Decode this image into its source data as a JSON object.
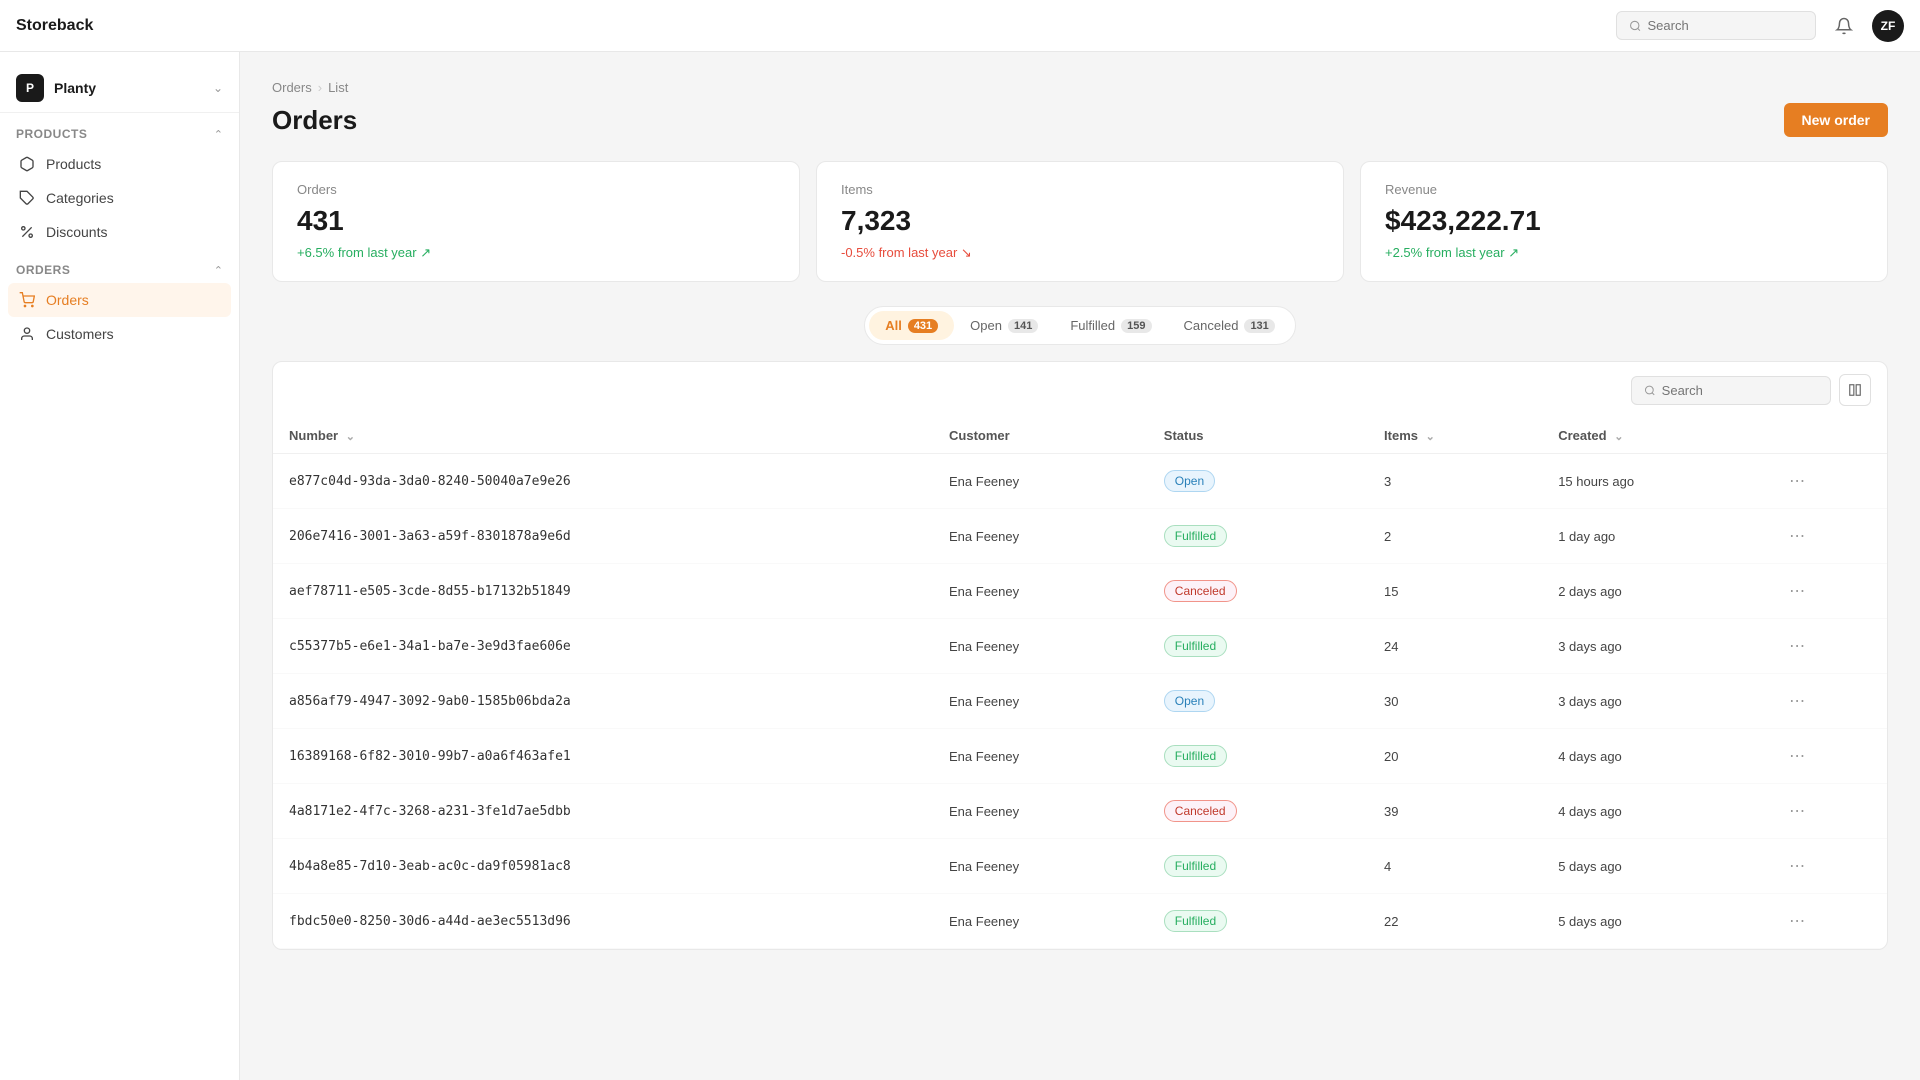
{
  "app": {
    "brand": "Storeback",
    "avatar": "ZF"
  },
  "topbar": {
    "search_placeholder": "Search"
  },
  "sidebar": {
    "store_name": "Planty",
    "store_initial": "P",
    "products_section": "Products",
    "orders_section": "Orders",
    "items": [
      {
        "id": "products",
        "label": "Products",
        "icon": "box"
      },
      {
        "id": "categories",
        "label": "Categories",
        "icon": "tag"
      },
      {
        "id": "discounts",
        "label": "Discounts",
        "icon": "percent"
      },
      {
        "id": "orders",
        "label": "Orders",
        "icon": "cart",
        "active": true
      },
      {
        "id": "customers",
        "label": "Customers",
        "icon": "user"
      }
    ]
  },
  "breadcrumb": {
    "parent": "Orders",
    "current": "List"
  },
  "page": {
    "title": "Orders",
    "new_order_label": "New order"
  },
  "stats": [
    {
      "id": "orders",
      "label": "Orders",
      "value": "431",
      "change": "+6.5% from last year",
      "positive": true
    },
    {
      "id": "items",
      "label": "Items",
      "value": "7,323",
      "change": "-0.5% from last year",
      "positive": false
    },
    {
      "id": "revenue",
      "label": "Revenue",
      "value": "$423,222.71",
      "change": "+2.5% from last year",
      "positive": true
    }
  ],
  "filter_tabs": [
    {
      "id": "all",
      "label": "All",
      "count": "431",
      "active": true
    },
    {
      "id": "open",
      "label": "Open",
      "count": "141",
      "active": false
    },
    {
      "id": "fulfilled",
      "label": "Fulfilled",
      "count": "159",
      "active": false
    },
    {
      "id": "canceled",
      "label": "Canceled",
      "count": "131",
      "active": false
    }
  ],
  "table": {
    "search_placeholder": "Search",
    "columns": [
      {
        "id": "number",
        "label": "Number",
        "sortable": true
      },
      {
        "id": "customer",
        "label": "Customer",
        "sortable": false
      },
      {
        "id": "status",
        "label": "Status",
        "sortable": false
      },
      {
        "id": "items",
        "label": "Items",
        "sortable": true
      },
      {
        "id": "created",
        "label": "Created",
        "sortable": true
      }
    ],
    "rows": [
      {
        "id": "e877c04d-93da-3da0-8240-50040a7e9e26",
        "customer": "Ena Feeney",
        "status": "Open",
        "items": "3",
        "created": "15 hours ago"
      },
      {
        "id": "206e7416-3001-3a63-a59f-8301878a9e6d",
        "customer": "Ena Feeney",
        "status": "Fulfilled",
        "items": "2",
        "created": "1 day ago"
      },
      {
        "id": "aef78711-e505-3cde-8d55-b17132b51849",
        "customer": "Ena Feeney",
        "status": "Canceled",
        "items": "15",
        "created": "2 days ago"
      },
      {
        "id": "c55377b5-e6e1-34a1-ba7e-3e9d3fae606e",
        "customer": "Ena Feeney",
        "status": "Fulfilled",
        "items": "24",
        "created": "3 days ago"
      },
      {
        "id": "a856af79-4947-3092-9ab0-1585b06bda2a",
        "customer": "Ena Feeney",
        "status": "Open",
        "items": "30",
        "created": "3 days ago"
      },
      {
        "id": "16389168-6f82-3010-99b7-a0a6f463afe1",
        "customer": "Ena Feeney",
        "status": "Fulfilled",
        "items": "20",
        "created": "4 days ago"
      },
      {
        "id": "4a8171e2-4f7c-3268-a231-3fe1d7ae5dbb",
        "customer": "Ena Feeney",
        "status": "Canceled",
        "items": "39",
        "created": "4 days ago"
      },
      {
        "id": "4b4a8e85-7d10-3eab-ac0c-da9f05981ac8",
        "customer": "Ena Feeney",
        "status": "Fulfilled",
        "items": "4",
        "created": "5 days ago"
      },
      {
        "id": "fbdc50e0-8250-30d6-a44d-ae3ec5513d96",
        "customer": "Ena Feeney",
        "status": "Fulfilled",
        "items": "22",
        "created": "5 days ago"
      }
    ]
  }
}
